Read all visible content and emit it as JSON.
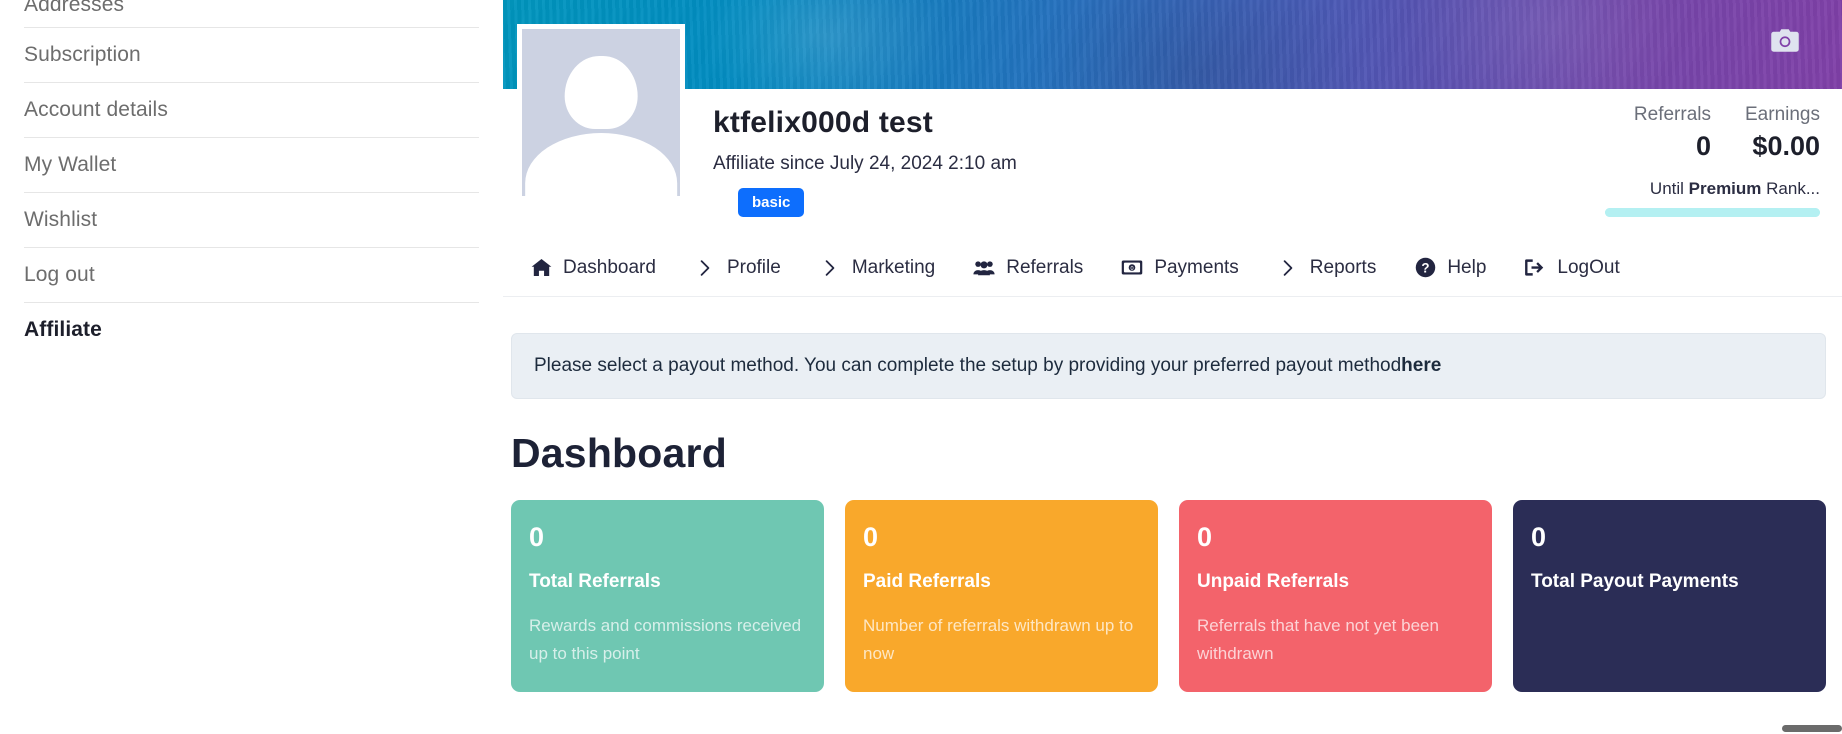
{
  "sidebar": {
    "items": [
      {
        "label": "Addresses",
        "active": false
      },
      {
        "label": "Subscription",
        "active": false
      },
      {
        "label": "Account details",
        "active": false
      },
      {
        "label": "My Wallet",
        "active": false
      },
      {
        "label": "Wishlist",
        "active": false
      },
      {
        "label": "Log out",
        "active": false
      },
      {
        "label": "Affiliate",
        "active": true
      }
    ]
  },
  "cover": {
    "camera_icon": "camera-icon",
    "gradient_from": "#0097bd",
    "gradient_to": "#8041a9"
  },
  "profile": {
    "avatar_alt": "default-avatar",
    "name": "ktfelix000d test",
    "since": "Affiliate since July 24, 2024 2:10 am",
    "rank_badge": "basic",
    "rank_badge_color": "#0d6efd",
    "stats": [
      {
        "label": "Referrals",
        "value": "0"
      },
      {
        "label": "Earnings",
        "value": "$0.00"
      }
    ],
    "progress": {
      "prefix": "Until ",
      "rank": "Premium",
      "suffix": " Rank...",
      "percent": 0,
      "track_color": "#b4f0f2"
    }
  },
  "nav": {
    "items": [
      {
        "label": "Dashboard",
        "icon": "home-icon"
      },
      {
        "label": "Profile",
        "icon": "chevron-right-icon"
      },
      {
        "label": "Marketing",
        "icon": "chevron-right-icon"
      },
      {
        "label": "Referrals",
        "icon": "users-icon"
      },
      {
        "label": "Payments",
        "icon": "money-bill-icon"
      },
      {
        "label": "Reports",
        "icon": "chevron-right-icon"
      },
      {
        "label": "Help",
        "icon": "question-circle-icon"
      },
      {
        "label": "LogOut",
        "icon": "sign-out-icon"
      }
    ]
  },
  "alert": {
    "text": "Please select a payout method. You can complete the setup by providing your preferred payout method",
    "link_text": "here"
  },
  "dashboard": {
    "title": "Dashboard",
    "cards": [
      {
        "value": "0",
        "title": "Total Referrals",
        "description": "Rewards and commissions received up to this point",
        "color": "#6fc7b2"
      },
      {
        "value": "0",
        "title": "Paid Referrals",
        "description": "Number of referrals withdrawn up to now",
        "color": "#f9a82b"
      },
      {
        "value": "0",
        "title": "Unpaid Referrals",
        "description": "Referrals that have not yet been withdrawn",
        "color": "#f3636b"
      },
      {
        "value": "0",
        "title": "Total Payout Payments",
        "description": "",
        "color": "#2b2d56"
      }
    ]
  }
}
